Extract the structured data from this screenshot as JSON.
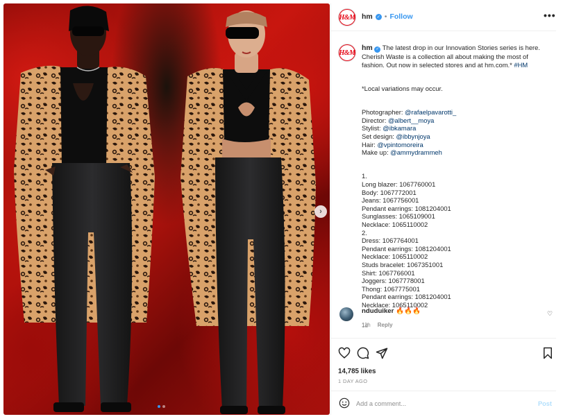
{
  "post": {
    "username": "hm",
    "follow_label": "Follow",
    "separator": "•",
    "more_label": "•••",
    "avatar_text": "H&M",
    "verified_glyph": "✓"
  },
  "caption": {
    "intro": " The latest drop in our Innovation Stories series is here. Cherish Waste is a collection all about making the most of fashion. Out now in selected stores and at hm.com.* ",
    "hashtag": "#HM",
    "note": "*Local variations may occur.",
    "credits": [
      {
        "label": "Photographer: ",
        "mention": "@rafaelpavarotti_"
      },
      {
        "label": "Director: ",
        "mention": "@albert__moya"
      },
      {
        "label": "Stylist: ",
        "mention": "@ibkamara"
      },
      {
        "label": "Set design: ",
        "mention": "@ibbynjoya"
      },
      {
        "label": "Hair: ",
        "mention": "@vpintomoreira"
      },
      {
        "label": "Make up: ",
        "mention": "@ammydrammeh"
      }
    ],
    "items": "1.\nLong blazer: 1067760001\nBody: 1067772001\nJeans: 1067756001\nPendant earrings: 1081204001\nSunglasses: 1065109001\nNecklace: 1065110002\n2.\nDress: 1067764001\nPendant earrings: 1081204001\nNecklace: 1065110002\nStuds bracelet: 1067351001\nShirt: 1067766001\nJoggers: 1067778001\nThong: 1067775001\nPendant earrings: 1081204001\nNecklace: 1065110002",
    "time": "1d"
  },
  "comment": {
    "username": "nduduiker",
    "text": "🔥🔥🔥",
    "time": "11h",
    "reply_label": "Reply",
    "heart_glyph": "♡"
  },
  "actions": {
    "likes": "14,785 likes",
    "date": "1 DAY AGO"
  },
  "add_comment": {
    "placeholder": "Add a comment...",
    "post_label": "Post"
  },
  "carousel": {
    "arrow_glyph": "›",
    "current_slide": 1,
    "total_slides": 2
  },
  "colors": {
    "accent": "#3897f0",
    "brand_red": "#e50010",
    "mention": "#00376b",
    "muted": "#8e8e8e"
  }
}
